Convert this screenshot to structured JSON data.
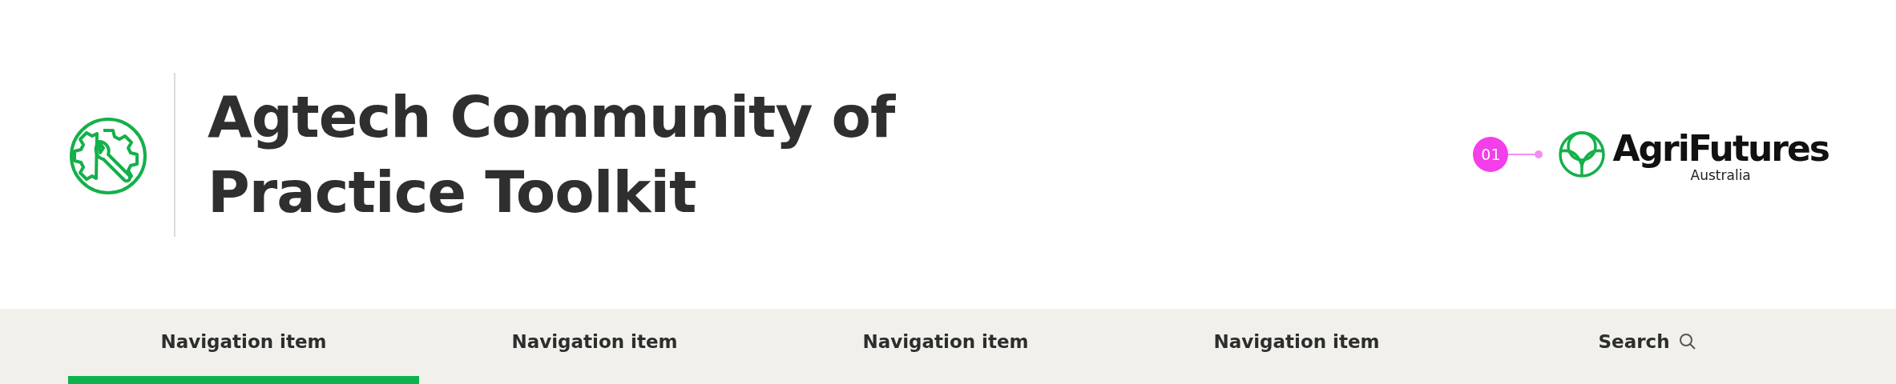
{
  "header": {
    "title_lines": [
      "Agtech Community of",
      "Practice Toolkit"
    ],
    "annotation_marker": "01",
    "brand": {
      "name": "AgriFutures",
      "subtitle": "Australia"
    }
  },
  "nav": {
    "items": [
      {
        "label": "Navigation item",
        "kind": "link",
        "selected": true
      },
      {
        "label": "Navigation item",
        "kind": "link",
        "selected": false
      },
      {
        "label": "Navigation item",
        "kind": "link",
        "selected": false
      },
      {
        "label": "Navigation item",
        "kind": "link",
        "selected": false
      },
      {
        "label": "Search",
        "kind": "search",
        "selected": false
      }
    ]
  }
}
